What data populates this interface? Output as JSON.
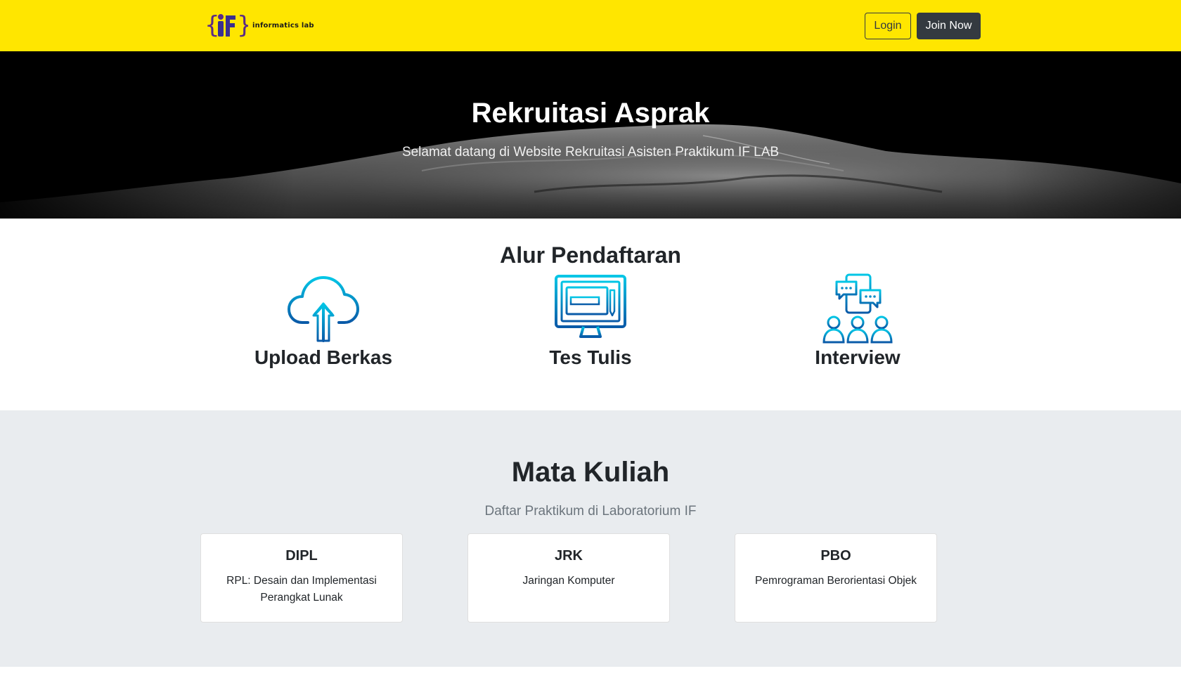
{
  "navbar": {
    "brand_text": "informatics lab",
    "login_label": "Login",
    "join_label": "Join Now",
    "bg_color": "#ffe600"
  },
  "hero": {
    "title": "Rekruitasi Asprak",
    "subtitle": "Selamat datang di Website Rekruitasi Asisten Praktikum IF LAB"
  },
  "alur": {
    "title": "Alur Pendaftaran",
    "steps": [
      {
        "label": "Upload Berkas",
        "icon": "cloud-upload-icon"
      },
      {
        "label": "Tes Tulis",
        "icon": "computer-test-icon"
      },
      {
        "label": "Interview",
        "icon": "people-chat-icon"
      }
    ]
  },
  "mata_kuliah": {
    "title": "Mata Kuliah",
    "subtitle": "Daftar Praktikum di Laboratorium IF",
    "courses": [
      {
        "code": "DIPL",
        "name": "RPL: Desain dan Implementasi Perangkat Lunak"
      },
      {
        "code": "JRK",
        "name": "Jaringan Komputer"
      },
      {
        "code": "PBO",
        "name": "Pemrograman Berorientasi Objek"
      }
    ]
  },
  "colors": {
    "accent": "#ffe600",
    "dark_button": "#343a40",
    "icon_gradient_start": "#00c6e6",
    "icon_gradient_end": "#0a5aa8"
  }
}
